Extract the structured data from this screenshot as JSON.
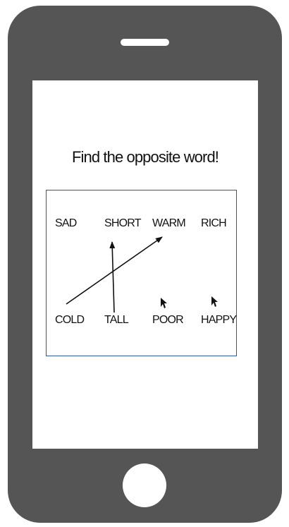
{
  "title": "Find the opposite word!",
  "words": {
    "top": [
      "SAD",
      "SHORT",
      "WARM",
      "RICH"
    ],
    "bottom": [
      "COLD",
      "TALL",
      "POOR",
      "HAPPY"
    ]
  },
  "colors": {
    "phone_body": "#555555",
    "screen": "#ffffff",
    "board_border": "#2f56a0"
  }
}
